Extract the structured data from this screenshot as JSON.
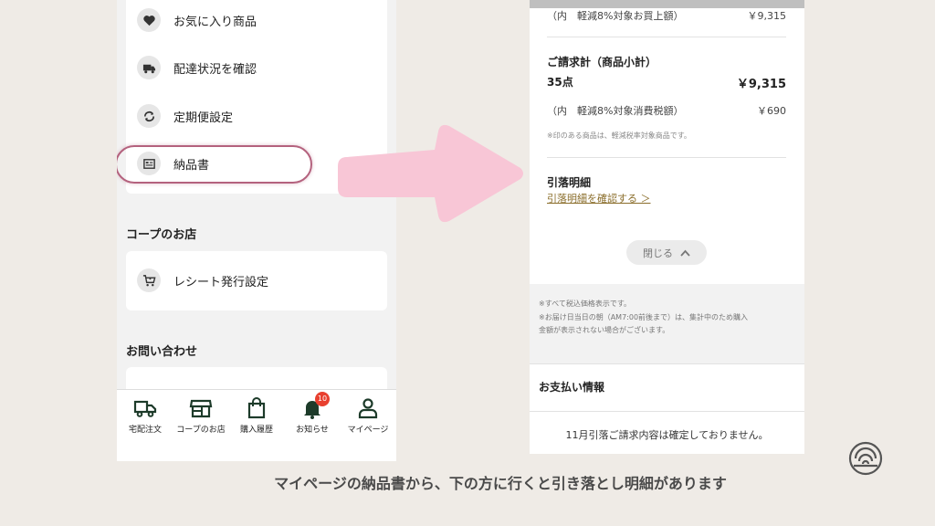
{
  "left_phone": {
    "menu_items": [
      {
        "label": "お気に入り商品",
        "icon": "heart-icon"
      },
      {
        "label": "配達状況を確認",
        "icon": "truck-icon"
      },
      {
        "label": "定期便設定",
        "icon": "refresh-icon"
      },
      {
        "label": "納品書",
        "icon": "invoice-icon"
      }
    ],
    "highlight_color": "#b4627e",
    "store_section": {
      "title": "コープのお店",
      "items": [
        {
          "label": "レシート発行設定",
          "icon": "cart-icon"
        }
      ]
    },
    "contact_section": {
      "title": "お問い合わせ"
    },
    "tabbar": {
      "tabs": [
        {
          "label": "宅配注文",
          "icon": "truck-icon"
        },
        {
          "label": "コープのお店",
          "icon": "store-icon"
        },
        {
          "label": "購入履歴",
          "icon": "shopping-bag-icon"
        },
        {
          "label": "お知らせ",
          "icon": "bell-icon",
          "badge": "10"
        },
        {
          "label": "マイページ",
          "icon": "person-icon"
        }
      ]
    }
  },
  "arrow_color": "#f8c6d6",
  "right_phone": {
    "reduced_tax_purchase_label": "（内　軽減8%対象お買上額）",
    "reduced_tax_purchase_amount": "￥9,315",
    "billing_total_title": "ご請求計（商品小計）",
    "item_count": "35点",
    "billing_total_amount": "￥9,315",
    "reduced_tax_label": "（内　軽減8%対象消費税額）",
    "reduced_tax_amount": "￥690",
    "reduced_tax_note": "※印のある商品は、軽減税率対象商品です。",
    "withdrawal_title": "引落明細",
    "withdrawal_link": "引落明細を確認する ＞",
    "close_label": "閉じる",
    "notes": [
      "※すべて税込価格表示です。",
      "※お届け日当日の朝（AM7:00前後まで）は、集計中のため購入",
      "金額が表示されない場合がございます。"
    ],
    "payment_info_title": "お支払い情報",
    "bill_status": "11月引落ご請求内容は確定しておりません。"
  },
  "caption": "マイページの納品書から、下の方に行くと引き落とし明細があります",
  "brand_logo_icon": "spiral-logo-icon"
}
